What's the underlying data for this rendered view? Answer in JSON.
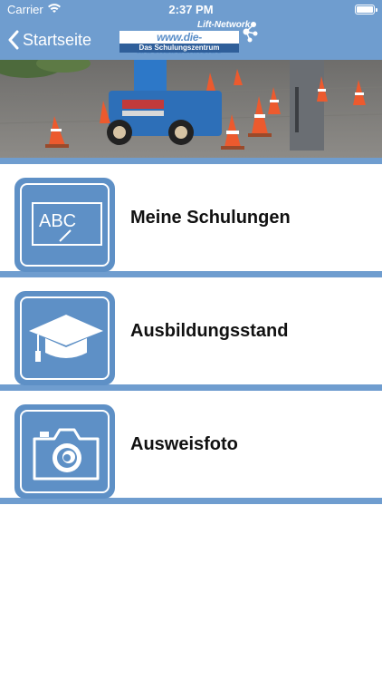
{
  "status_bar": {
    "carrier": "Carrier",
    "time": "2:37 PM"
  },
  "navbar": {
    "back_label": "Startseite",
    "logo": {
      "network": "Lift-Network",
      "brand": "www.die-arbeitsbuehne.de",
      "tagline": "Das Schulungszentrum"
    }
  },
  "menu": {
    "items": [
      {
        "label": "Meine Schulungen",
        "icon": "abc-board-icon",
        "board_text": "ABC"
      },
      {
        "label": "Ausbildungsstand",
        "icon": "graduation-cap-icon"
      },
      {
        "label": "Ausweisfoto",
        "icon": "camera-icon"
      }
    ]
  },
  "colors": {
    "accent": "#6f9dcf",
    "icon_bg": "#5e90c6"
  }
}
